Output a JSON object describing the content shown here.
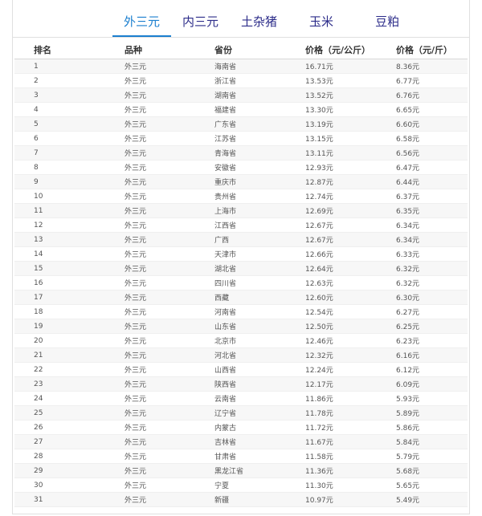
{
  "tabs": [
    {
      "label": "外三元",
      "active": true
    },
    {
      "label": "内三元",
      "active": false
    },
    {
      "label": "土杂猪",
      "active": false
    },
    {
      "label": "玉米",
      "active": false
    },
    {
      "label": "豆粕",
      "active": false
    }
  ],
  "table": {
    "headers": [
      "排名",
      "品种",
      "省份",
      "价格（元/公斤）",
      "价格（元/斤）"
    ],
    "rows": [
      [
        "1",
        "外三元",
        "海南省",
        "16.71元",
        "8.36元"
      ],
      [
        "2",
        "外三元",
        "浙江省",
        "13.53元",
        "6.77元"
      ],
      [
        "3",
        "外三元",
        "湖南省",
        "13.52元",
        "6.76元"
      ],
      [
        "4",
        "外三元",
        "福建省",
        "13.30元",
        "6.65元"
      ],
      [
        "5",
        "外三元",
        "广东省",
        "13.19元",
        "6.60元"
      ],
      [
        "6",
        "外三元",
        "江苏省",
        "13.15元",
        "6.58元"
      ],
      [
        "7",
        "外三元",
        "青海省",
        "13.11元",
        "6.56元"
      ],
      [
        "8",
        "外三元",
        "安徽省",
        "12.93元",
        "6.47元"
      ],
      [
        "9",
        "外三元",
        "重庆市",
        "12.87元",
        "6.44元"
      ],
      [
        "10",
        "外三元",
        "贵州省",
        "12.74元",
        "6.37元"
      ],
      [
        "11",
        "外三元",
        "上海市",
        "12.69元",
        "6.35元"
      ],
      [
        "12",
        "外三元",
        "江西省",
        "12.67元",
        "6.34元"
      ],
      [
        "13",
        "外三元",
        "广西",
        "12.67元",
        "6.34元"
      ],
      [
        "14",
        "外三元",
        "天津市",
        "12.66元",
        "6.33元"
      ],
      [
        "15",
        "外三元",
        "湖北省",
        "12.64元",
        "6.32元"
      ],
      [
        "16",
        "外三元",
        "四川省",
        "12.63元",
        "6.32元"
      ],
      [
        "17",
        "外三元",
        "西藏",
        "12.60元",
        "6.30元"
      ],
      [
        "18",
        "外三元",
        "河南省",
        "12.54元",
        "6.27元"
      ],
      [
        "19",
        "外三元",
        "山东省",
        "12.50元",
        "6.25元"
      ],
      [
        "20",
        "外三元",
        "北京市",
        "12.46元",
        "6.23元"
      ],
      [
        "21",
        "外三元",
        "河北省",
        "12.32元",
        "6.16元"
      ],
      [
        "22",
        "外三元",
        "山西省",
        "12.24元",
        "6.12元"
      ],
      [
        "23",
        "外三元",
        "陕西省",
        "12.17元",
        "6.09元"
      ],
      [
        "24",
        "外三元",
        "云南省",
        "11.86元",
        "5.93元"
      ],
      [
        "25",
        "外三元",
        "辽宁省",
        "11.78元",
        "5.89元"
      ],
      [
        "26",
        "外三元",
        "内蒙古",
        "11.72元",
        "5.86元"
      ],
      [
        "27",
        "外三元",
        "吉林省",
        "11.67元",
        "5.84元"
      ],
      [
        "28",
        "外三元",
        "甘肃省",
        "11.58元",
        "5.79元"
      ],
      [
        "29",
        "外三元",
        "黑龙江省",
        "11.36元",
        "5.68元"
      ],
      [
        "30",
        "外三元",
        "宁夏",
        "11.30元",
        "5.65元"
      ],
      [
        "31",
        "外三元",
        "新疆",
        "10.97元",
        "5.49元"
      ]
    ]
  }
}
